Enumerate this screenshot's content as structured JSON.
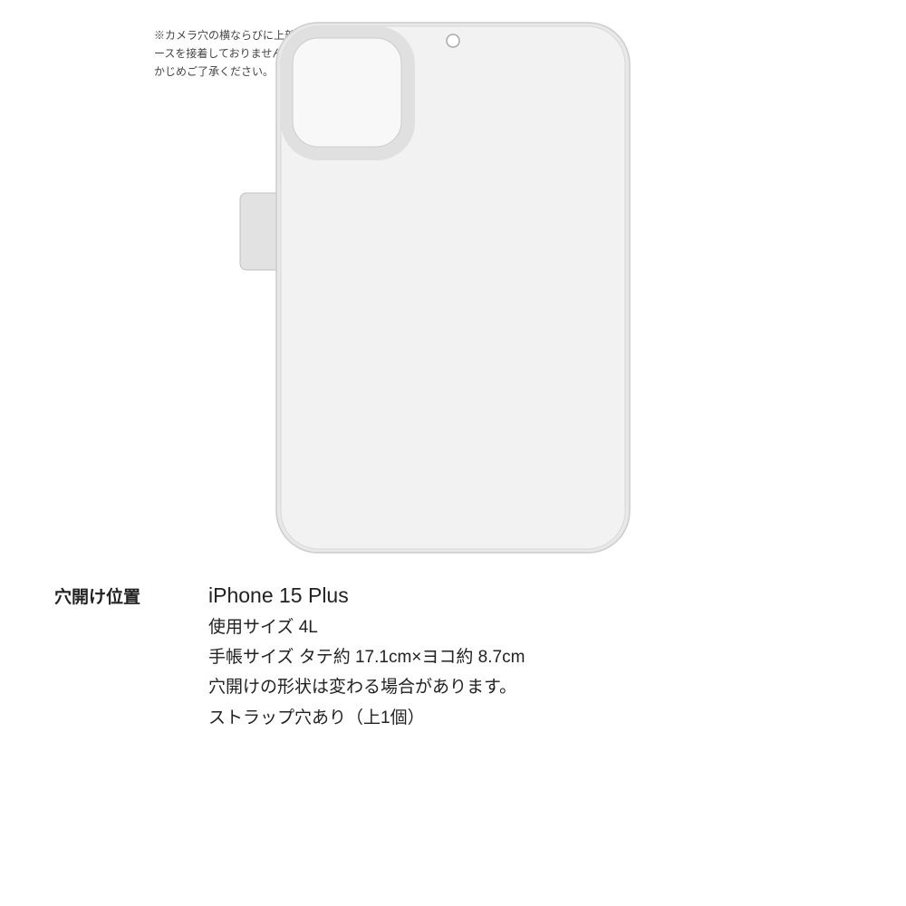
{
  "page": {
    "background_color": "#ffffff"
  },
  "annotation": {
    "text": "※カメラ穴の横ならびに上部はケースを接着しておりません。あらかじめご了承ください。"
  },
  "hole_position": {
    "label": "穴開け位置"
  },
  "product_info": {
    "model": "iPhone 15 Plus",
    "size_label": "使用サイズ 4L",
    "dimensions_label": "手帳サイズ タテ約 17.1cm×ヨコ約 8.7cm",
    "shape_note": "穴開けの形状は変わる場合があります。",
    "strap_note": "ストラップ穴あり（上1個）"
  }
}
